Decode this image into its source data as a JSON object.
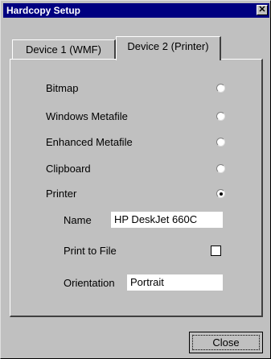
{
  "window": {
    "title": "Hardcopy Setup"
  },
  "tabs": [
    "Device 1 (WMF)",
    "Device 2 (Printer)"
  ],
  "selected_tab": "Device 2 (Printer)",
  "options": [
    {
      "label": "Bitmap",
      "selected": false
    },
    {
      "label": "Windows Metafile",
      "selected": false
    },
    {
      "label": "Enhanced Metafile",
      "selected": false
    },
    {
      "label": "Clipboard",
      "selected": false
    },
    {
      "label": "Printer",
      "selected": true
    }
  ],
  "printer": {
    "name_label": "Name",
    "name_value": "HP DeskJet 660C",
    "print_to_file_label": "Print to File",
    "print_to_file_checked": false,
    "orientation_label": "Orientation",
    "orientation_value": "Portrait"
  },
  "buttons": {
    "close": "Close"
  },
  "colors": {
    "titlebar": "#000080",
    "face": "#c0c0c0"
  }
}
